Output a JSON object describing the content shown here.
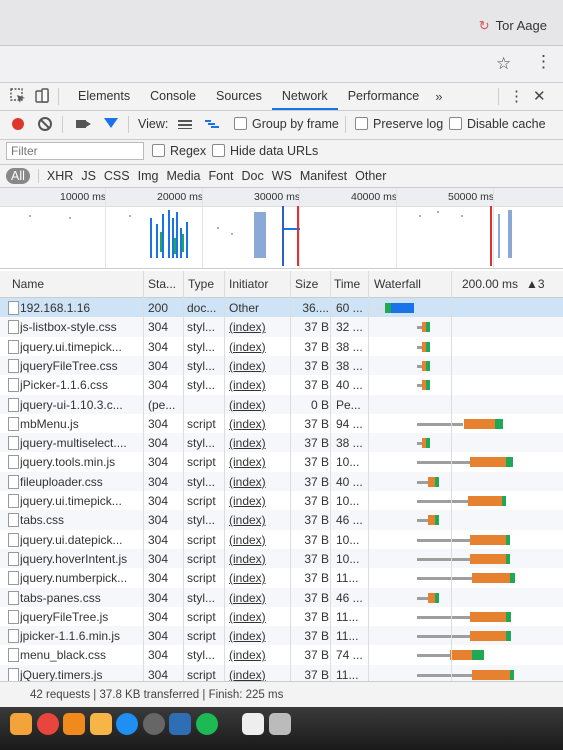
{
  "browser": {
    "profile_name": "Tor Aage"
  },
  "devtools": {
    "tabs": [
      "Elements",
      "Console",
      "Sources",
      "Network",
      "Performance"
    ],
    "active_tab": "Network",
    "more_tabs": "»",
    "toolbar": {
      "view_label": "View:",
      "group_by_frame": "Group by frame",
      "preserve_log": "Preserve log",
      "disable_cache": "Disable cache"
    },
    "filter": {
      "placeholder": "Filter",
      "regex": "Regex",
      "hide_data_urls": "Hide data URLs"
    },
    "resource_types": [
      "All",
      "XHR",
      "JS",
      "CSS",
      "Img",
      "Media",
      "Font",
      "Doc",
      "WS",
      "Manifest",
      "Other"
    ],
    "overview_ticks": [
      "10000 ms",
      "20000 ms",
      "30000 ms",
      "40000 ms",
      "50000 ms"
    ],
    "columns": {
      "name": "Name",
      "status": "Sta...",
      "type": "Type",
      "initiator": "Initiator",
      "size": "Size",
      "time": "Time",
      "waterfall": "Waterfall",
      "waterfall_scale": "200.00 ms",
      "sort_indicator": "▲3"
    },
    "requests": [
      {
        "name": "192.168.1.16",
        "status": "200",
        "type": "doc...",
        "initiator": "Other",
        "size": "36....",
        "time": "60 ...",
        "wf_start": 0.02,
        "wf_wait": 0.08,
        "wf_recv": 0.28,
        "wf_color": "#1a73e8"
      },
      {
        "name": "js-listbox-style.css",
        "status": "304",
        "type": "styl...",
        "initiator": "(index)",
        "size": "37 B",
        "time": "32 ...",
        "wf_start": 0.24,
        "wf_wait": 0.05,
        "wf_recv": 0.05,
        "wf_color": "#1fa855"
      },
      {
        "name": "jquery.ui.timepick...",
        "status": "304",
        "type": "styl...",
        "initiator": "(index)",
        "size": "37 B",
        "time": "38 ...",
        "wf_start": 0.24,
        "wf_wait": 0.05,
        "wf_recv": 0.05,
        "wf_color": "#1fa855"
      },
      {
        "name": "jqueryFileTree.css",
        "status": "304",
        "type": "styl...",
        "initiator": "(index)",
        "size": "37 B",
        "time": "38 ...",
        "wf_start": 0.24,
        "wf_wait": 0.05,
        "wf_recv": 0.05,
        "wf_color": "#1fa855"
      },
      {
        "name": "jPicker-1.1.6.css",
        "status": "304",
        "type": "styl...",
        "initiator": "(index)",
        "size": "37 B",
        "time": "40 ...",
        "wf_start": 0.24,
        "wf_wait": 0.05,
        "wf_recv": 0.05,
        "wf_color": "#1fa855"
      },
      {
        "name": "jquery-ui-1.10.3.c...",
        "status": "(pe...",
        "type": "",
        "initiator": "(index)",
        "size": "0 B",
        "time": "Pe...",
        "wf_start": 0,
        "wf_wait": 0,
        "wf_recv": 0,
        "wf_color": "#cccccc"
      },
      {
        "name": "mbMenu.js",
        "status": "304",
        "type": "script",
        "initiator": "(index)",
        "size": "37 B",
        "time": "94 ...",
        "wf_start": 0.24,
        "wf_wait": 0.42,
        "wf_recv": 0.1,
        "wf_color": "#1fa855"
      },
      {
        "name": "jquery-multiselect....",
        "status": "304",
        "type": "styl...",
        "initiator": "(index)",
        "size": "37 B",
        "time": "38 ...",
        "wf_start": 0.24,
        "wf_wait": 0.05,
        "wf_recv": 0.05,
        "wf_color": "#1fa855"
      },
      {
        "name": "jquery.tools.min.js",
        "status": "304",
        "type": "script",
        "initiator": "(index)",
        "size": "37 B",
        "time": "10...",
        "wf_start": 0.24,
        "wf_wait": 0.48,
        "wf_recv": 0.08,
        "wf_color": "#1fa855"
      },
      {
        "name": "fileuploader.css",
        "status": "304",
        "type": "styl...",
        "initiator": "(index)",
        "size": "37 B",
        "time": "40 ...",
        "wf_start": 0.24,
        "wf_wait": 0.1,
        "wf_recv": 0.05,
        "wf_color": "#1fa855"
      },
      {
        "name": "jquery.ui.timepick...",
        "status": "304",
        "type": "script",
        "initiator": "(index)",
        "size": "37 B",
        "time": "10...",
        "wf_start": 0.24,
        "wf_wait": 0.46,
        "wf_recv": 0.05,
        "wf_color": "#1fa855"
      },
      {
        "name": "tabs.css",
        "status": "304",
        "type": "styl...",
        "initiator": "(index)",
        "size": "37 B",
        "time": "46 ...",
        "wf_start": 0.24,
        "wf_wait": 0.1,
        "wf_recv": 0.05,
        "wf_color": "#1fa855"
      },
      {
        "name": "jquery.ui.datepick...",
        "status": "304",
        "type": "script",
        "initiator": "(index)",
        "size": "37 B",
        "time": "10...",
        "wf_start": 0.24,
        "wf_wait": 0.48,
        "wf_recv": 0.05,
        "wf_color": "#1fa855"
      },
      {
        "name": "jquery.hoverIntent.js",
        "status": "304",
        "type": "script",
        "initiator": "(index)",
        "size": "37 B",
        "time": "10...",
        "wf_start": 0.24,
        "wf_wait": 0.48,
        "wf_recv": 0.05,
        "wf_color": "#1fa855"
      },
      {
        "name": "jquery.numberpick...",
        "status": "304",
        "type": "script",
        "initiator": "(index)",
        "size": "37 B",
        "time": "11...",
        "wf_start": 0.24,
        "wf_wait": 0.5,
        "wf_recv": 0.06,
        "wf_color": "#1fa855"
      },
      {
        "name": "tabs-panes.css",
        "status": "304",
        "type": "styl...",
        "initiator": "(index)",
        "size": "37 B",
        "time": "46 ...",
        "wf_start": 0.24,
        "wf_wait": 0.1,
        "wf_recv": 0.05,
        "wf_color": "#1fa855"
      },
      {
        "name": "jqueryFileTree.js",
        "status": "304",
        "type": "script",
        "initiator": "(index)",
        "size": "37 B",
        "time": "11...",
        "wf_start": 0.24,
        "wf_wait": 0.48,
        "wf_recv": 0.06,
        "wf_color": "#1fa855"
      },
      {
        "name": "jpicker-1.1.6.min.js",
        "status": "304",
        "type": "script",
        "initiator": "(index)",
        "size": "37 B",
        "time": "11...",
        "wf_start": 0.24,
        "wf_wait": 0.48,
        "wf_recv": 0.06,
        "wf_color": "#1fa855"
      },
      {
        "name": "menu_black.css",
        "status": "304",
        "type": "styl...",
        "initiator": "(index)",
        "size": "37 B",
        "time": "74 ...",
        "wf_start": 0.24,
        "wf_wait": 0.3,
        "wf_recv": 0.14,
        "wf_color": "#1fa855"
      },
      {
        "name": "jQuery.timers.js",
        "status": "304",
        "type": "script",
        "initiator": "(index)",
        "size": "37 B",
        "time": "11...",
        "wf_start": 0.24,
        "wf_wait": 0.5,
        "wf_recv": 0.05,
        "wf_color": "#1fa855"
      }
    ],
    "summary": "42 requests | 37.8 KB transferred | Finish: 225 ms"
  },
  "colors": {
    "accent": "#1a73e8",
    "record": "#e0352b",
    "waiting": "#e6822f",
    "stalled": "#9e9e9e",
    "selected_row": "#cfe3f7"
  },
  "dock_icons": [
    "photos-icon",
    "chrome-icon",
    "vlc-icon",
    "firefox-icon",
    "appstore-icon",
    "camera-icon",
    "xcode-icon",
    "spotify-icon",
    "document-icon",
    "trash-icon"
  ]
}
